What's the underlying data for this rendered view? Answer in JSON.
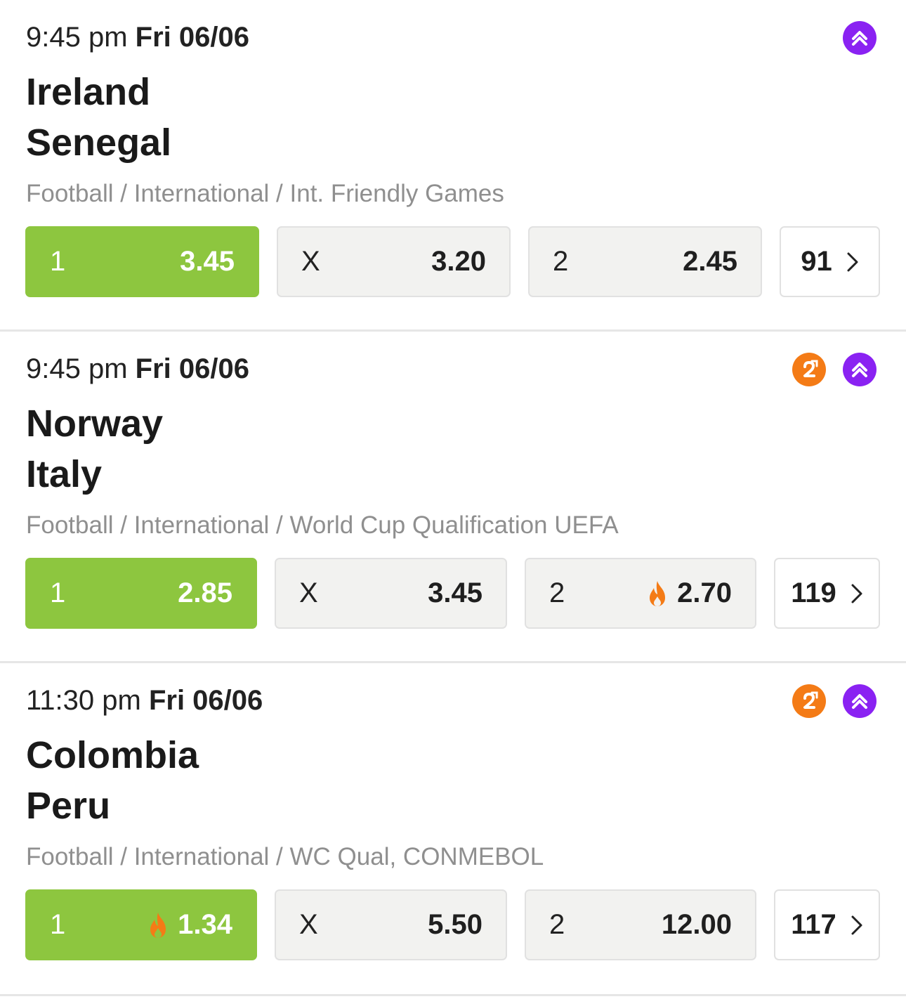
{
  "colors": {
    "selected": "#8dc63f",
    "boost_badge": "#8a22f2",
    "two_up_badge": "#f47b16",
    "hot_flame": "#f47b16"
  },
  "matches": [
    {
      "time": "9:45 pm",
      "date": "Fri 06/06",
      "badges": [
        "boost-icon"
      ],
      "home": "Ireland",
      "away": "Senegal",
      "league": "Football / International / Int. Friendly Games",
      "odds": [
        {
          "label": "1",
          "price": "3.45",
          "selected": true,
          "hot": false
        },
        {
          "label": "X",
          "price": "3.20",
          "selected": false,
          "hot": false
        },
        {
          "label": "2",
          "price": "2.45",
          "selected": false,
          "hot": false
        }
      ],
      "more_markets": "91"
    },
    {
      "time": "9:45 pm",
      "date": "Fri 06/06",
      "badges": [
        "two-up-icon",
        "boost-icon"
      ],
      "home": "Norway",
      "away": "Italy",
      "league": "Football / International / World Cup Qualification UEFA",
      "odds": [
        {
          "label": "1",
          "price": "2.85",
          "selected": true,
          "hot": false
        },
        {
          "label": "X",
          "price": "3.45",
          "selected": false,
          "hot": false
        },
        {
          "label": "2",
          "price": "2.70",
          "selected": false,
          "hot": true
        }
      ],
      "more_markets": "119"
    },
    {
      "time": "11:30 pm",
      "date": "Fri 06/06",
      "badges": [
        "two-up-icon",
        "boost-icon"
      ],
      "home": "Colombia",
      "away": "Peru",
      "league": "Football / International / WC Qual, CONMEBOL",
      "odds": [
        {
          "label": "1",
          "price": "1.34",
          "selected": true,
          "hot": true
        },
        {
          "label": "X",
          "price": "5.50",
          "selected": false,
          "hot": false
        },
        {
          "label": "2",
          "price": "12.00",
          "selected": false,
          "hot": false
        }
      ],
      "more_markets": "117"
    }
  ]
}
